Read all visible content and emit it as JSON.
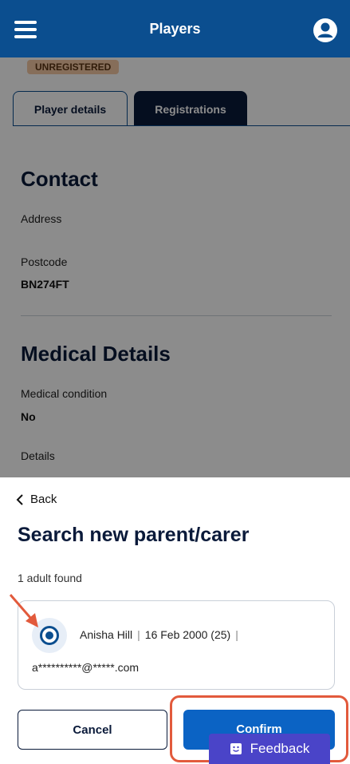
{
  "header": {
    "title": "Players",
    "menu_icon": "menu-icon",
    "account_icon": "account-icon"
  },
  "player": {
    "status_badge": "UNREGISTERED"
  },
  "tabs": [
    {
      "label": "Player details",
      "active": false
    },
    {
      "label": "Registrations",
      "active": true
    }
  ],
  "contact": {
    "title": "Contact",
    "address_label": "Address",
    "postcode_label": "Postcode",
    "postcode_value": "BN274FT"
  },
  "medical": {
    "title": "Medical Details",
    "condition_label": "Medical condition",
    "condition_value": "No",
    "details_label": "Details"
  },
  "sheet": {
    "back_label": "Back",
    "title": "Search new parent/carer",
    "found_text": "1 adult found",
    "result": {
      "name": "Anisha Hill",
      "dob": "16 Feb 2000 (25)",
      "email": "a**********@*****.com",
      "selected": true
    },
    "cancel_label": "Cancel",
    "confirm_label": "Confirm"
  },
  "feedback_label": "Feedback",
  "colors": {
    "header_bg": "#0b4e8f",
    "confirm_bg": "#0b63c4",
    "highlight": "#e25a3c",
    "feedback_bg": "#4a44c8"
  }
}
